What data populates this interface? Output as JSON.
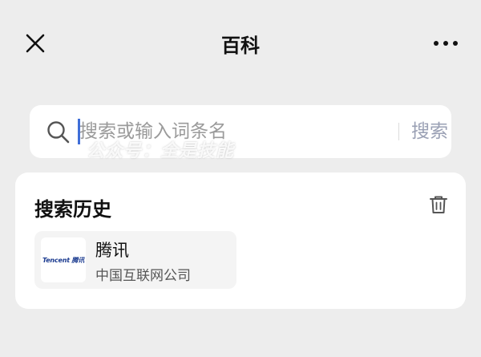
{
  "header": {
    "title": "百科",
    "close_icon": "close-icon",
    "more_icon": "more-horizontal-icon"
  },
  "search": {
    "placeholder": "搜索或输入词条名",
    "value": "",
    "button_label": "搜索",
    "icon": "search-icon"
  },
  "watermark": "公众号：全是技能",
  "history": {
    "title": "搜索历史",
    "clear_icon": "trash-icon",
    "items": [
      {
        "title": "腾讯",
        "subtitle": "中国互联网公司",
        "logo_text": "Tencent 腾讯"
      }
    ]
  },
  "colors": {
    "background": "#ededed",
    "card": "#ffffff",
    "caret": "#3f6ed8",
    "search_button": "#9aa0b4"
  }
}
